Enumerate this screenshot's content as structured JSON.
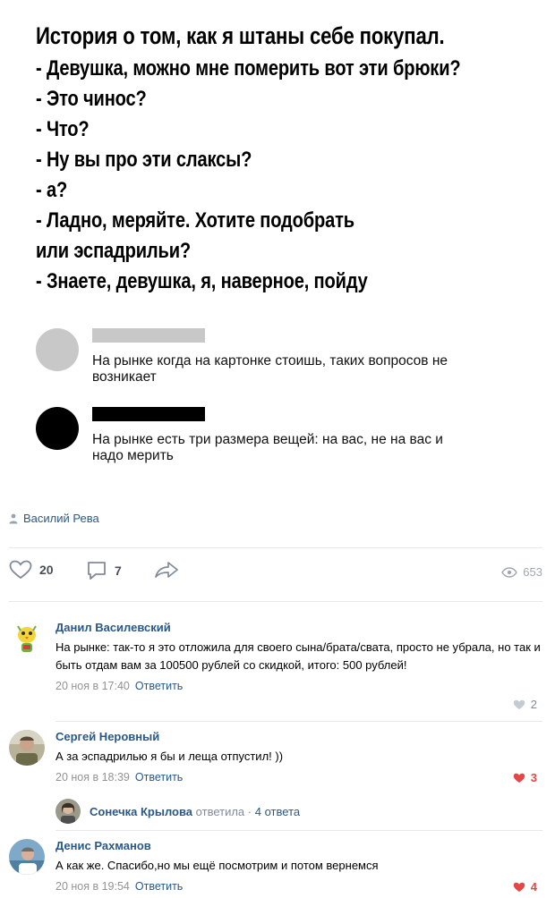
{
  "meme": {
    "lines": [
      "История о том, как я штаны себе покупал.",
      "- Девушка, можно мне померить вот эти брюки?",
      "- Это чинос?",
      "- Что?",
      "- Ну вы про эти слаксы?",
      "- а?",
      "- Ладно, меряйте. Хотите подобрать",
      "или эспадрильи?",
      "- Знаете, девушка, я, наверное, пойду"
    ],
    "comments": [
      {
        "text": "На рынке когда на картонке стоишь, таких вопросов не возникает",
        "avatar_color": "#c8c8c8",
        "bar_color": "#c8c8c8"
      },
      {
        "text": "На рынке есть три размера вещей: на вас, не на вас и надо мерить",
        "avatar_color": "#000000",
        "bar_color": "#000000"
      }
    ]
  },
  "post": {
    "author": "Василий Рева",
    "author_icon": "person-icon",
    "likes": "20",
    "comments": "7",
    "views": "653"
  },
  "comments": [
    {
      "author": "Данил Василевский",
      "text": "На рынке: так-то я это отложила для своего сына/брата/свата, просто не убрала, но так и быть отдам вам за 100500 рублей со скидкой, итого: 500 рублей!",
      "time": "20 ноя в 17:40",
      "reply": "Ответить",
      "likes": "2"
    },
    {
      "author": "Сергей Неровный",
      "text": "А за эспадрилью я бы и леща отпустил! ))",
      "time": "20 ноя в 18:39",
      "reply": "Ответить",
      "likes": "3"
    },
    {
      "author": "Денис Рахманов",
      "text": "А как же. Спасибо,но мы ещё посмотрим и потом вернемся",
      "time": "20 ноя в 19:54",
      "reply": "Ответить",
      "likes": "4"
    }
  ],
  "thread": {
    "name": "Сонечка Крылова",
    "verb": "ответила",
    "sep": "·",
    "count": "4 ответа"
  },
  "colors": {
    "link": "#2a5885",
    "muted": "#828a99",
    "like_red": "#e64646"
  }
}
